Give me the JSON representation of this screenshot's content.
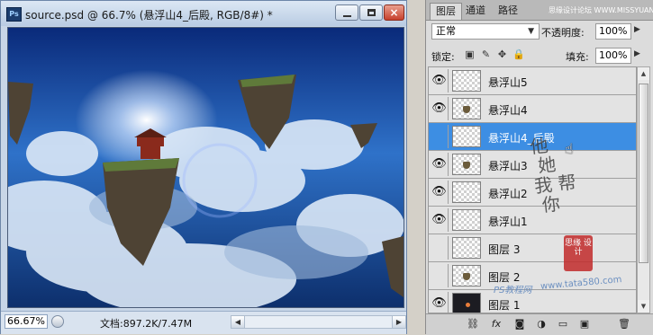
{
  "document": {
    "app_icon": "Ps",
    "title": "source.psd @ 66.7% (悬浮山4_后殿, RGB/8#) *",
    "zoom": "66.67%",
    "doc_size": "文档:897.2K/7.47M",
    "close_glyph": "×"
  },
  "panel": {
    "tabs": [
      "图层",
      "通道",
      "路径"
    ],
    "active_tab": "图层",
    "watermark_top": "思缘设计论坛  WWW.MISSYUAN.COM",
    "blend_mode": "正常",
    "opacity_label": "不透明度:",
    "opacity": "100%",
    "lock_label": "锁定:",
    "fill_label": "填充:",
    "fill": "100%",
    "layers": [
      {
        "name": "悬浮山5",
        "visible": true,
        "selected": false,
        "thumb": "transparent"
      },
      {
        "name": "悬浮山4",
        "visible": true,
        "selected": false,
        "thumb": "rock"
      },
      {
        "name": "悬浮山4_后殿",
        "visible": false,
        "selected": true,
        "thumb": "transparent"
      },
      {
        "name": "悬浮山3",
        "visible": true,
        "selected": false,
        "thumb": "rock"
      },
      {
        "name": "悬浮山2",
        "visible": true,
        "selected": false,
        "thumb": "transparent"
      },
      {
        "name": "悬浮山1",
        "visible": true,
        "selected": false,
        "thumb": "transparent"
      },
      {
        "name": "图层 3",
        "visible": false,
        "selected": false,
        "thumb": "transparent"
      },
      {
        "name": "图层 2",
        "visible": false,
        "selected": false,
        "thumb": "rock"
      },
      {
        "name": "图层 1",
        "visible": true,
        "selected": false,
        "thumb": "dark"
      }
    ],
    "bottom_icons": [
      "link-icon",
      "fx-icon",
      "mask-icon",
      "adjustment-icon",
      "group-icon",
      "new-layer-icon",
      "trash-icon"
    ],
    "bottom_glyphs": [
      "⛓",
      "fx",
      "◙",
      "◑",
      "▭",
      "▣",
      "🗑"
    ],
    "lock_glyphs": [
      "▣",
      "✎",
      "✥",
      "🔒"
    ],
    "eye_glyph": "👁"
  },
  "watermarks": {
    "script": "他\n 她\n我 帮\n 你",
    "seal": "思缘 设计",
    "ps_site": "PS教程网",
    "url": "www.tata580.com"
  }
}
